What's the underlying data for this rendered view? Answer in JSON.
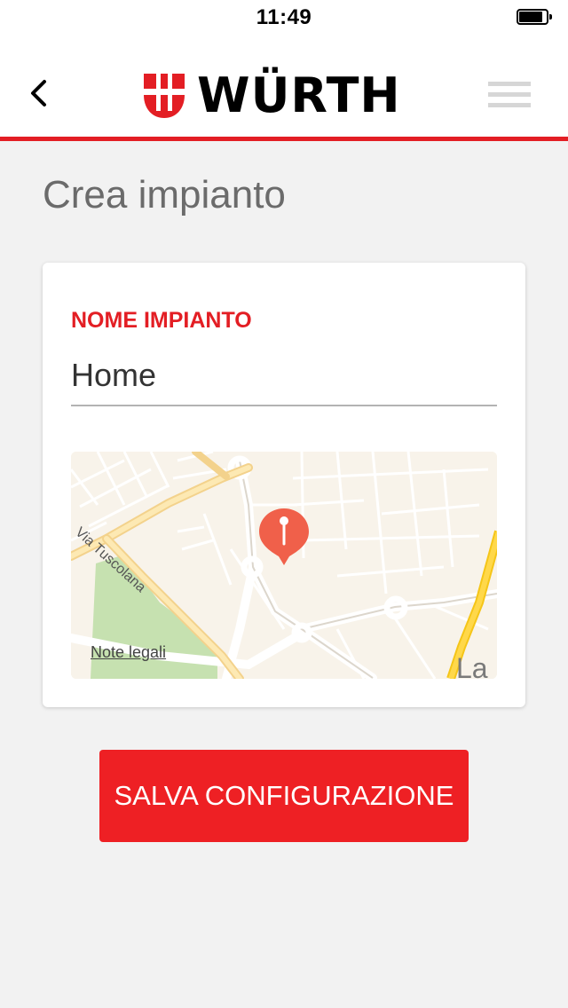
{
  "status_bar": {
    "time": "11:49"
  },
  "header": {
    "brand_name": "WÜRTH",
    "accent_color": "#e31e24",
    "back_icon": "chevron-left-icon",
    "menu_icon": "hamburger-menu-icon"
  },
  "page": {
    "title": "Crea impianto"
  },
  "form": {
    "name_label": "NOME IMPIANTO",
    "name_value": "Home"
  },
  "map": {
    "street_label": "Via Tuscolana",
    "legal_link": "Note legali",
    "corner_label": "La",
    "pin_icon": "location-pin-icon",
    "pin_color": "#f0604a"
  },
  "actions": {
    "save_label": "SALVA CONFIGURAZIONE",
    "save_color": "#ee2024"
  }
}
